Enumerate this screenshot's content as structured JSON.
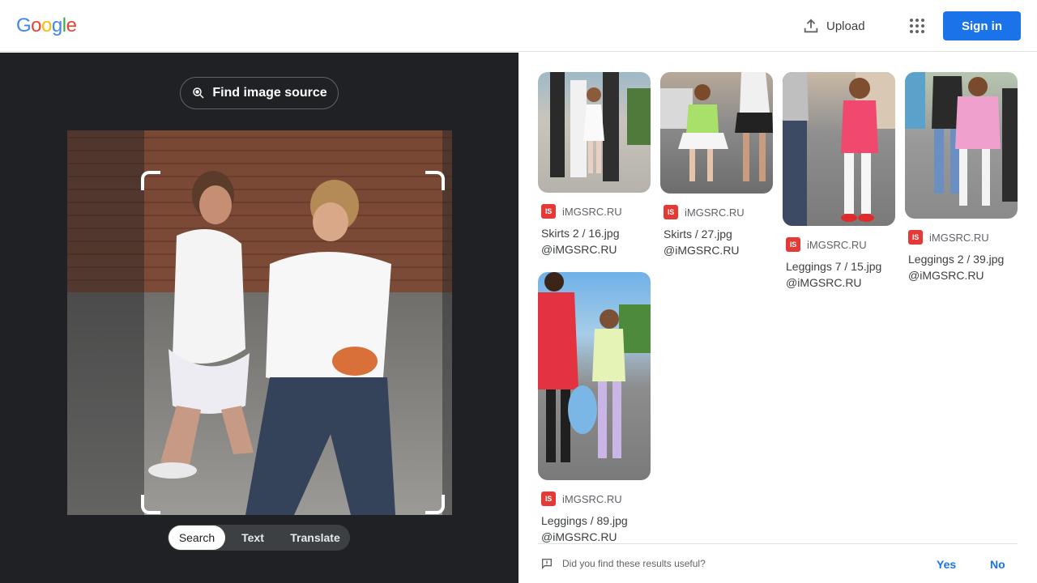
{
  "header": {
    "logo_letters": [
      {
        "ch": "G",
        "color": "#4285F4"
      },
      {
        "ch": "o",
        "color": "#EA4335"
      },
      {
        "ch": "o",
        "color": "#FBBC05"
      },
      {
        "ch": "g",
        "color": "#4285F4"
      },
      {
        "ch": "l",
        "color": "#34A853"
      },
      {
        "ch": "e",
        "color": "#EA4335"
      }
    ],
    "upload_label": "Upload",
    "signin_label": "Sign in"
  },
  "left": {
    "find_source_label": "Find image source",
    "modes": [
      "Search",
      "Text",
      "Translate"
    ],
    "active_mode": "Search"
  },
  "results": [
    {
      "source": "iMGSRC.RU",
      "badge": "IS",
      "title_line1": "Skirts 2 / 16.jpg",
      "title_line2": "@iMGSRC.RU"
    },
    {
      "source": "iMGSRC.RU",
      "badge": "IS",
      "title_line1": "Skirts / 27.jpg",
      "title_line2": "@iMGSRC.RU"
    },
    {
      "source": "iMGSRC.RU",
      "badge": "IS",
      "title_line1": "Leggings 7 / 15.jpg",
      "title_line2": "@iMGSRC.RU"
    },
    {
      "source": "iMGSRC.RU",
      "badge": "IS",
      "title_line1": "Leggings 2 / 39.jpg",
      "title_line2": "@iMGSRC.RU"
    },
    {
      "source": "iMGSRC.RU",
      "badge": "IS",
      "title_line1": "Leggings / 89.jpg",
      "title_line2": "@iMGSRC.RU"
    }
  ],
  "feedback": {
    "question": "Did you find these results useful?",
    "yes": "Yes",
    "no": "No"
  },
  "colors": {
    "accent": "#1a73e8",
    "dark_pane": "#202124",
    "source_badge": "#e53935"
  }
}
